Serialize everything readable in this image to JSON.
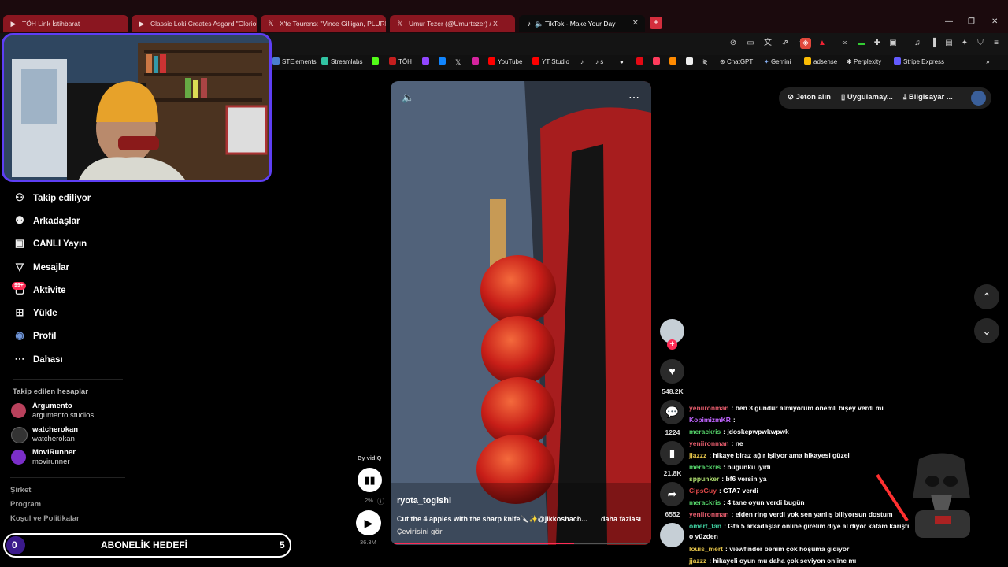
{
  "browser": {
    "tabs": [
      {
        "title": "TÖH Link İstihbarat",
        "icon": "youtube-icon"
      },
      {
        "title": "Classic Loki Creates Asgard \"Gloriou",
        "icon": "youtube-icon"
      },
      {
        "title": "X'te Tourens: \"Vince Gilligan, PLURIB",
        "icon": "x-icon"
      },
      {
        "title": "Umur Tezer (@Umurtezer) / X",
        "icon": "x-icon"
      },
      {
        "title": "TikTok - Make Your Day",
        "icon": "tiktok-icon"
      }
    ],
    "bookmarks": [
      "STElements",
      "Streamlabs",
      "TÖH",
      "YouTube",
      "YT Studio",
      "s",
      "ChatGPT",
      "Gemini",
      "adsense",
      "Perplexity",
      "Stripe Express"
    ]
  },
  "sidebar": {
    "nav": [
      {
        "label": "Takip ediliyor",
        "icon": "following-icon"
      },
      {
        "label": "Arkadaşlar",
        "icon": "friends-icon"
      },
      {
        "label": "CANLI Yayın",
        "icon": "live-icon"
      },
      {
        "label": "Mesajlar",
        "icon": "messages-icon"
      },
      {
        "label": "Aktivite",
        "icon": "activity-icon",
        "badge": "99+"
      },
      {
        "label": "Yükle",
        "icon": "upload-icon"
      },
      {
        "label": "Profil",
        "icon": "profile-icon"
      },
      {
        "label": "Dahası",
        "icon": "more-icon"
      }
    ],
    "followed_title": "Takip edilen hesaplar",
    "followed": [
      {
        "name": "Argumento",
        "handle": "argumento.studios"
      },
      {
        "name": "watcherokan",
        "handle": "watcherokan"
      },
      {
        "name": "MoviRunner",
        "handle": "movirunner"
      }
    ],
    "footer": [
      "Şirket",
      "Program",
      "Koşul ve Politikalar"
    ]
  },
  "header": {
    "coins": "Jeton alın",
    "app": "Uygulamay...",
    "desktop": "Bilgisayar ..."
  },
  "video": {
    "author": "ryota_togishi",
    "caption": "Cut the 4 apples with the sharp knife🔪✨@jikkoshach...",
    "more": "daha fazlası",
    "translate": "Çevirisini gör",
    "vidiq_label": "By vidIQ",
    "vidiq_percent": "2%",
    "vidiq_views": "36.3M"
  },
  "actions": {
    "likes": "548.2K",
    "comments": "1224",
    "saves": "21.8K",
    "shares": "6552"
  },
  "chat": [
    {
      "user": "yeniironman",
      "msg": ": ben 3 gündür almıyorum önemli bişey verdi mi",
      "color": "#e05a6a"
    },
    {
      "user": "KopimizmKR",
      "msg": ":",
      "color": "#c064ff"
    },
    {
      "user": "merackris",
      "msg": ": jdoskepwpwkwpwk",
      "color": "#55d36a"
    },
    {
      "user": "yeniironman",
      "msg": ": ne",
      "color": "#e05a6a"
    },
    {
      "user": "jjazzz",
      "msg": ": hikaye biraz ağır işliyor ama hikayesi güzel",
      "color": "#e6c54a"
    },
    {
      "user": "merackris",
      "msg": ": bugünkü iyidi",
      "color": "#55d36a"
    },
    {
      "user": "sppunker",
      "msg": ": bf6 versin ya",
      "color": "#b0e070"
    },
    {
      "user": "CipsGuy",
      "msg": ": GTA7 verdi",
      "color": "#e04848"
    },
    {
      "user": "merackris",
      "msg": ": 4 tane oyun verdi bugün",
      "color": "#55d36a"
    },
    {
      "user": "yeniironman",
      "msg": ": elden ring verdi yok sen yanlış biliyorsun dostum",
      "color": "#e05a6a"
    },
    {
      "user": "omert_tan",
      "msg": ": Gta 5 arkadaşlar online girelim diye al diyor kafam karıştı",
      "color": "#3fd0a0"
    },
    {
      "user": "",
      "msg": "o yüzden",
      "color": "#ffffff"
    },
    {
      "user": "louis_mert",
      "msg": ": viewfinder benim çok hoşuma gidiyor",
      "color": "#e6c54a"
    },
    {
      "user": "jjazzz",
      "msg": ": hikayeli oyun mu daha çok seviyon online mı",
      "color": "#e6c54a"
    }
  ],
  "sub_goal": {
    "label": "ABONELİK HEDEFİ",
    "current": "0",
    "target": "5"
  },
  "colors": {
    "tab_red": "#8a1620",
    "accent_red": "#fe2c55",
    "webcam_border": "#5e3ff5"
  }
}
